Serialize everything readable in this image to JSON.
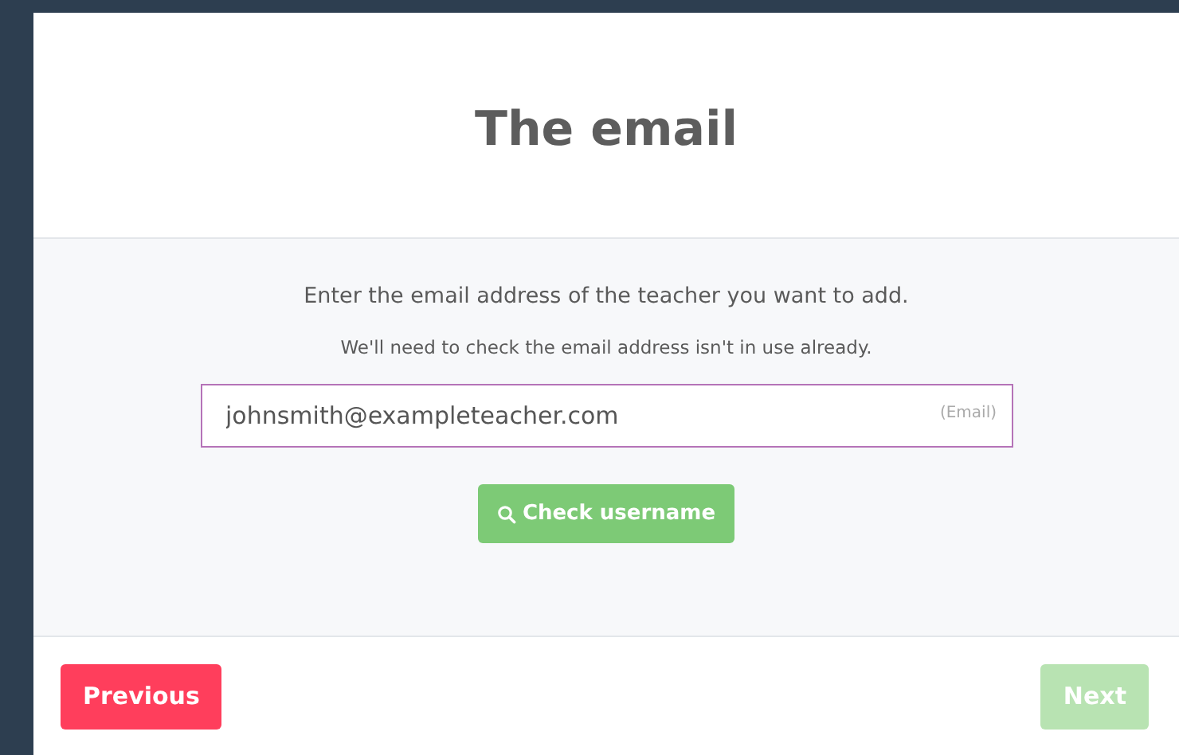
{
  "modal": {
    "title": "The email"
  },
  "instructions": [
    "Enter the email address of the teacher you want to add.",
    "We'll need to check the email address isn't in use already."
  ],
  "email_field": {
    "value": "johnsmith@exampleteacher.com",
    "label": "(Email)",
    "focused": true
  },
  "check_button": {
    "label": "Check username"
  },
  "footer_buttons": [
    {
      "kind": "previous",
      "label": "Previous",
      "disabled": false
    },
    {
      "kind": "next",
      "label": "Next",
      "disabled": true
    }
  ]
}
